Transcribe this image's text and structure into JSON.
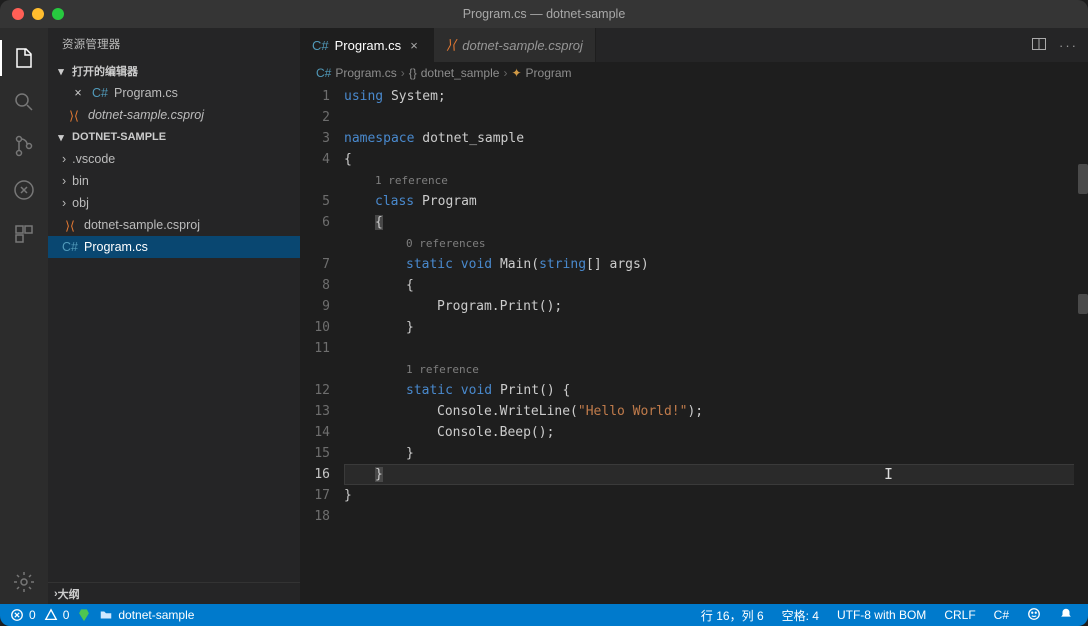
{
  "titlebar": {
    "title": "Program.cs — dotnet-sample"
  },
  "sidebar": {
    "header": "资源管理器",
    "open_editors_title": "打开的编辑器",
    "open_editors": [
      {
        "label": "Program.cs",
        "icon": "cs",
        "modified": false,
        "active": true
      },
      {
        "label": "dotnet-sample.csproj",
        "icon": "xml",
        "modified": false,
        "active": false
      }
    ],
    "workspace_name": "DOTNET-SAMPLE",
    "files": [
      {
        "label": ".vscode",
        "type": "folder"
      },
      {
        "label": "bin",
        "type": "folder"
      },
      {
        "label": "obj",
        "type": "folder"
      },
      {
        "label": "dotnet-sample.csproj",
        "type": "file",
        "icon": "xml"
      },
      {
        "label": "Program.cs",
        "type": "file",
        "icon": "cs",
        "active": true
      }
    ],
    "outline_title": "大纲"
  },
  "tabs": [
    {
      "label": "Program.cs",
      "icon": "cs",
      "active": true
    },
    {
      "label": "dotnet-sample.csproj",
      "icon": "xml",
      "active": false
    }
  ],
  "breadcrumb": {
    "file": "Program.cs",
    "ns": "dotnet_sample",
    "class": "Program"
  },
  "codelens": {
    "class": "1 reference",
    "main": "0 references",
    "print": "1 reference"
  },
  "code": {
    "l1": "using System;",
    "l3a": "namespace",
    "l3b": " dotnet_sample",
    "l5": "class Program",
    "l7": "static void Main(string[] args)",
    "l9": "Program.Print();",
    "l12": "static void Print() {",
    "l13a": "Console.WriteLine(",
    "l13b": "\"Hello World!\"",
    "l13c": ");",
    "l14": "Console.Beep();"
  },
  "status": {
    "errors": "0",
    "warnings": "0",
    "folder": "dotnet-sample",
    "cursor": "行 16，列 6",
    "spaces": "空格: 4",
    "encoding": "UTF-8 with BOM",
    "eol": "CRLF",
    "language": "C#"
  }
}
